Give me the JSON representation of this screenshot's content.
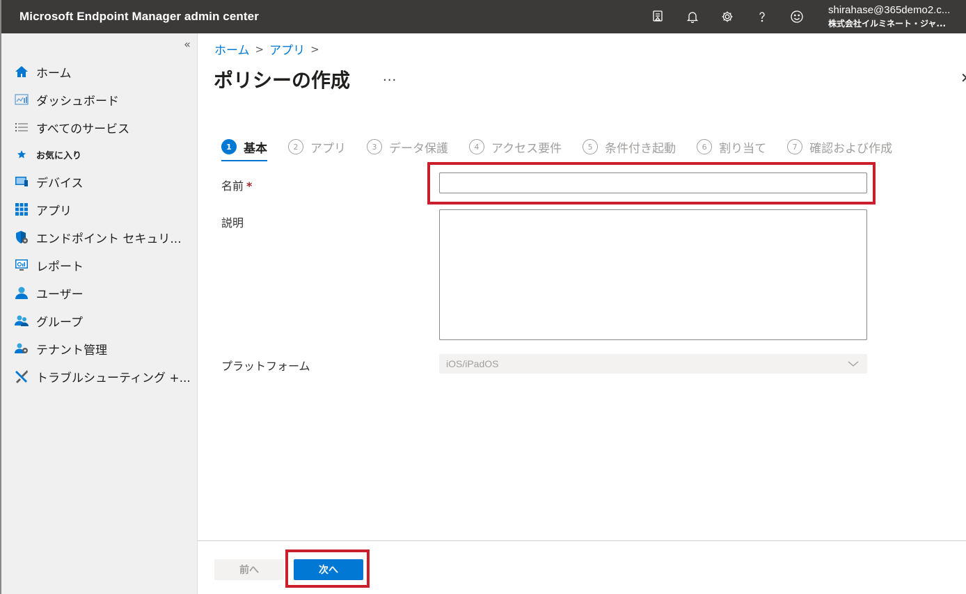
{
  "header": {
    "app_title": "Microsoft Endpoint Manager admin center",
    "account_email": "shirahase@365demo2.c...",
    "account_org": "株式会社イルミネート・ジャ..."
  },
  "sidebar": {
    "collapse_label": "«",
    "items": [
      {
        "label": "ホーム",
        "icon": "home-icon"
      },
      {
        "label": "ダッシュボード",
        "icon": "dashboard-icon"
      },
      {
        "label": "すべてのサービス",
        "icon": "list-icon"
      },
      {
        "label": "お気に入り",
        "icon": "star-icon"
      },
      {
        "label": "デバイス",
        "icon": "devices-icon"
      },
      {
        "label": "アプリ",
        "icon": "apps-grid-icon"
      },
      {
        "label": "エンドポイント セキュリ...",
        "icon": "shield-icon"
      },
      {
        "label": "レポート",
        "icon": "reports-icon"
      },
      {
        "label": "ユーザー",
        "icon": "user-icon"
      },
      {
        "label": "グループ",
        "icon": "group-icon"
      },
      {
        "label": "テナント管理",
        "icon": "tenant-admin-icon"
      },
      {
        "label": "トラブルシューティング +...",
        "icon": "tools-icon"
      }
    ]
  },
  "breadcrumb": {
    "home": "ホーム",
    "apps": "アプリ"
  },
  "page": {
    "title": "ポリシーの作成",
    "more": "..."
  },
  "steps": [
    {
      "num": "1",
      "label": "基本"
    },
    {
      "num": "2",
      "label": "アプリ"
    },
    {
      "num": "3",
      "label": "データ保護"
    },
    {
      "num": "4",
      "label": "アクセス要件"
    },
    {
      "num": "5",
      "label": "条件付き起動"
    },
    {
      "num": "6",
      "label": "割り当て"
    },
    {
      "num": "7",
      "label": "確認および作成"
    }
  ],
  "form": {
    "name_label": "名前",
    "required_mark": "*",
    "name_value": "",
    "description_label": "説明",
    "description_value": "",
    "platform_label": "プラットフォーム",
    "platform_value": "iOS/iPadOS"
  },
  "footer": {
    "prev_label": "前へ",
    "next_label": "次へ"
  },
  "colors": {
    "accent": "#0078d4",
    "topbar": "#3b3a39",
    "highlight": "#cc1f2d"
  }
}
